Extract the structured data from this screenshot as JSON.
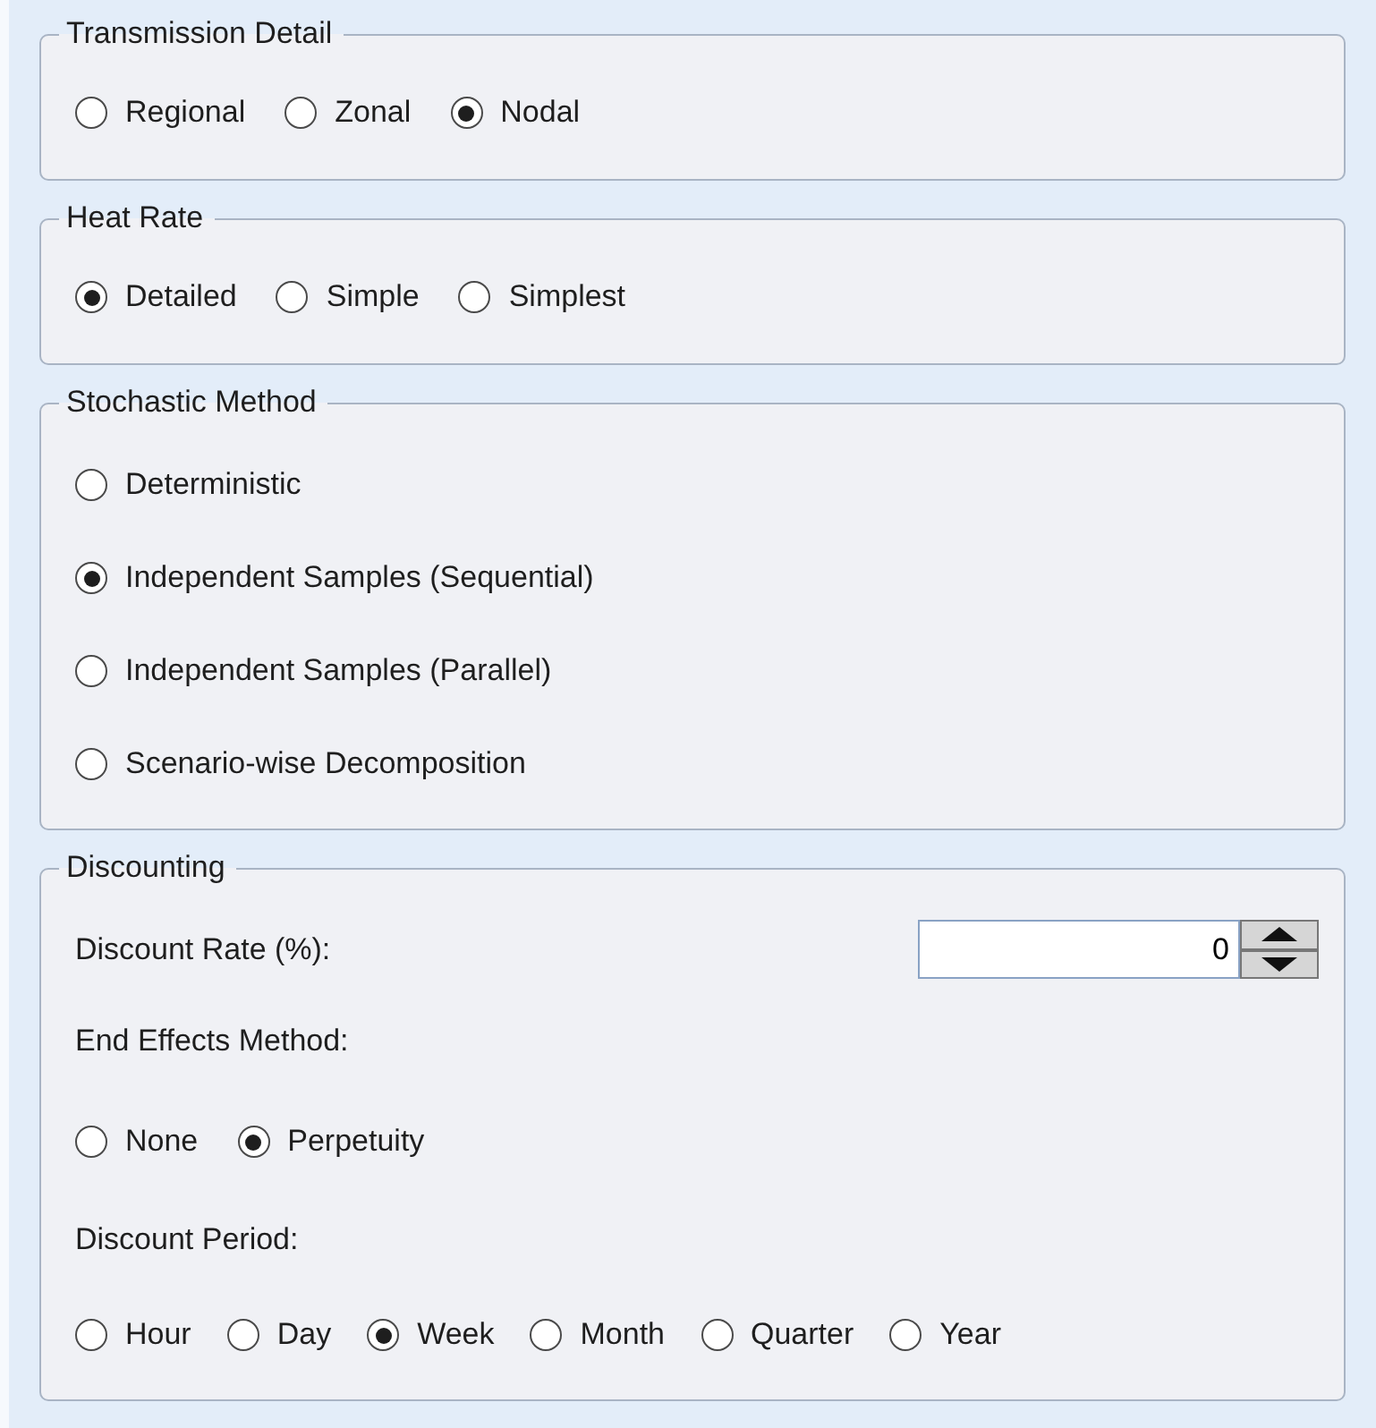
{
  "sections": [
    {
      "kind": "radio-row",
      "title": "Transmission Detail",
      "options": [
        {
          "label": "Regional",
          "selected": false
        },
        {
          "label": "Zonal",
          "selected": false
        },
        {
          "label": "Nodal",
          "selected": true
        }
      ]
    },
    {
      "kind": "radio-row",
      "title": "Heat Rate",
      "options": [
        {
          "label": "Detailed",
          "selected": true
        },
        {
          "label": "Simple",
          "selected": false
        },
        {
          "label": "Simplest",
          "selected": false
        }
      ]
    },
    {
      "kind": "radio-column",
      "title": "Stochastic Method",
      "options": [
        {
          "label": "Deterministic",
          "selected": false
        },
        {
          "label": "Independent Samples (Sequential)",
          "selected": true
        },
        {
          "label": "Independent Samples (Parallel)",
          "selected": false
        },
        {
          "label": "Scenario-wise Decomposition",
          "selected": false
        }
      ]
    },
    {
      "kind": "discounting",
      "title": "Discounting",
      "discount_rate": {
        "label": "Discount Rate (%):",
        "value": "0"
      },
      "end_effects": {
        "label": "End Effects Method:",
        "options": [
          {
            "label": "None",
            "selected": false
          },
          {
            "label": "Perpetuity",
            "selected": true
          }
        ]
      },
      "discount_period": {
        "label": "Discount Period:",
        "options": [
          {
            "label": "Hour",
            "selected": false
          },
          {
            "label": "Day",
            "selected": false
          },
          {
            "label": "Week",
            "selected": true
          },
          {
            "label": "Month",
            "selected": false
          },
          {
            "label": "Quarter",
            "selected": false
          },
          {
            "label": "Year",
            "selected": false
          }
        ]
      }
    }
  ]
}
